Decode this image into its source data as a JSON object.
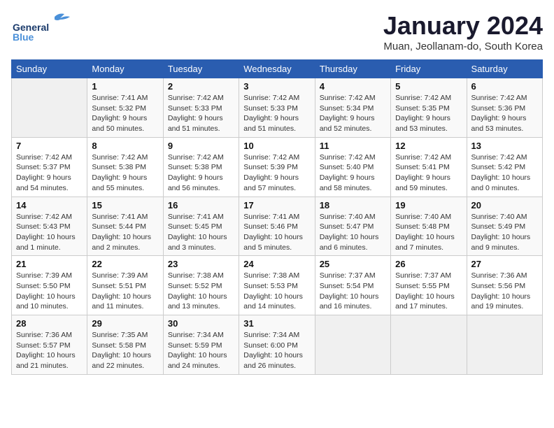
{
  "logo": {
    "line1": "General",
    "line2": "Blue"
  },
  "title": "January 2024",
  "location": "Muan, Jeollanam-do, South Korea",
  "days_of_week": [
    "Sunday",
    "Monday",
    "Tuesday",
    "Wednesday",
    "Thursday",
    "Friday",
    "Saturday"
  ],
  "weeks": [
    [
      {
        "day": "",
        "sunrise": "",
        "sunset": "",
        "daylight": ""
      },
      {
        "day": "1",
        "sunrise": "Sunrise: 7:41 AM",
        "sunset": "Sunset: 5:32 PM",
        "daylight": "Daylight: 9 hours and 50 minutes."
      },
      {
        "day": "2",
        "sunrise": "Sunrise: 7:42 AM",
        "sunset": "Sunset: 5:33 PM",
        "daylight": "Daylight: 9 hours and 51 minutes."
      },
      {
        "day": "3",
        "sunrise": "Sunrise: 7:42 AM",
        "sunset": "Sunset: 5:33 PM",
        "daylight": "Daylight: 9 hours and 51 minutes."
      },
      {
        "day": "4",
        "sunrise": "Sunrise: 7:42 AM",
        "sunset": "Sunset: 5:34 PM",
        "daylight": "Daylight: 9 hours and 52 minutes."
      },
      {
        "day": "5",
        "sunrise": "Sunrise: 7:42 AM",
        "sunset": "Sunset: 5:35 PM",
        "daylight": "Daylight: 9 hours and 53 minutes."
      },
      {
        "day": "6",
        "sunrise": "Sunrise: 7:42 AM",
        "sunset": "Sunset: 5:36 PM",
        "daylight": "Daylight: 9 hours and 53 minutes."
      }
    ],
    [
      {
        "day": "7",
        "sunrise": "Sunrise: 7:42 AM",
        "sunset": "Sunset: 5:37 PM",
        "daylight": "Daylight: 9 hours and 54 minutes."
      },
      {
        "day": "8",
        "sunrise": "Sunrise: 7:42 AM",
        "sunset": "Sunset: 5:38 PM",
        "daylight": "Daylight: 9 hours and 55 minutes."
      },
      {
        "day": "9",
        "sunrise": "Sunrise: 7:42 AM",
        "sunset": "Sunset: 5:38 PM",
        "daylight": "Daylight: 9 hours and 56 minutes."
      },
      {
        "day": "10",
        "sunrise": "Sunrise: 7:42 AM",
        "sunset": "Sunset: 5:39 PM",
        "daylight": "Daylight: 9 hours and 57 minutes."
      },
      {
        "day": "11",
        "sunrise": "Sunrise: 7:42 AM",
        "sunset": "Sunset: 5:40 PM",
        "daylight": "Daylight: 9 hours and 58 minutes."
      },
      {
        "day": "12",
        "sunrise": "Sunrise: 7:42 AM",
        "sunset": "Sunset: 5:41 PM",
        "daylight": "Daylight: 9 hours and 59 minutes."
      },
      {
        "day": "13",
        "sunrise": "Sunrise: 7:42 AM",
        "sunset": "Sunset: 5:42 PM",
        "daylight": "Daylight: 10 hours and 0 minutes."
      }
    ],
    [
      {
        "day": "14",
        "sunrise": "Sunrise: 7:42 AM",
        "sunset": "Sunset: 5:43 PM",
        "daylight": "Daylight: 10 hours and 1 minute."
      },
      {
        "day": "15",
        "sunrise": "Sunrise: 7:41 AM",
        "sunset": "Sunset: 5:44 PM",
        "daylight": "Daylight: 10 hours and 2 minutes."
      },
      {
        "day": "16",
        "sunrise": "Sunrise: 7:41 AM",
        "sunset": "Sunset: 5:45 PM",
        "daylight": "Daylight: 10 hours and 3 minutes."
      },
      {
        "day": "17",
        "sunrise": "Sunrise: 7:41 AM",
        "sunset": "Sunset: 5:46 PM",
        "daylight": "Daylight: 10 hours and 5 minutes."
      },
      {
        "day": "18",
        "sunrise": "Sunrise: 7:40 AM",
        "sunset": "Sunset: 5:47 PM",
        "daylight": "Daylight: 10 hours and 6 minutes."
      },
      {
        "day": "19",
        "sunrise": "Sunrise: 7:40 AM",
        "sunset": "Sunset: 5:48 PM",
        "daylight": "Daylight: 10 hours and 7 minutes."
      },
      {
        "day": "20",
        "sunrise": "Sunrise: 7:40 AM",
        "sunset": "Sunset: 5:49 PM",
        "daylight": "Daylight: 10 hours and 9 minutes."
      }
    ],
    [
      {
        "day": "21",
        "sunrise": "Sunrise: 7:39 AM",
        "sunset": "Sunset: 5:50 PM",
        "daylight": "Daylight: 10 hours and 10 minutes."
      },
      {
        "day": "22",
        "sunrise": "Sunrise: 7:39 AM",
        "sunset": "Sunset: 5:51 PM",
        "daylight": "Daylight: 10 hours and 11 minutes."
      },
      {
        "day": "23",
        "sunrise": "Sunrise: 7:38 AM",
        "sunset": "Sunset: 5:52 PM",
        "daylight": "Daylight: 10 hours and 13 minutes."
      },
      {
        "day": "24",
        "sunrise": "Sunrise: 7:38 AM",
        "sunset": "Sunset: 5:53 PM",
        "daylight": "Daylight: 10 hours and 14 minutes."
      },
      {
        "day": "25",
        "sunrise": "Sunrise: 7:37 AM",
        "sunset": "Sunset: 5:54 PM",
        "daylight": "Daylight: 10 hours and 16 minutes."
      },
      {
        "day": "26",
        "sunrise": "Sunrise: 7:37 AM",
        "sunset": "Sunset: 5:55 PM",
        "daylight": "Daylight: 10 hours and 17 minutes."
      },
      {
        "day": "27",
        "sunrise": "Sunrise: 7:36 AM",
        "sunset": "Sunset: 5:56 PM",
        "daylight": "Daylight: 10 hours and 19 minutes."
      }
    ],
    [
      {
        "day": "28",
        "sunrise": "Sunrise: 7:36 AM",
        "sunset": "Sunset: 5:57 PM",
        "daylight": "Daylight: 10 hours and 21 minutes."
      },
      {
        "day": "29",
        "sunrise": "Sunrise: 7:35 AM",
        "sunset": "Sunset: 5:58 PM",
        "daylight": "Daylight: 10 hours and 22 minutes."
      },
      {
        "day": "30",
        "sunrise": "Sunrise: 7:34 AM",
        "sunset": "Sunset: 5:59 PM",
        "daylight": "Daylight: 10 hours and 24 minutes."
      },
      {
        "day": "31",
        "sunrise": "Sunrise: 7:34 AM",
        "sunset": "Sunset: 6:00 PM",
        "daylight": "Daylight: 10 hours and 26 minutes."
      },
      {
        "day": "",
        "sunrise": "",
        "sunset": "",
        "daylight": ""
      },
      {
        "day": "",
        "sunrise": "",
        "sunset": "",
        "daylight": ""
      },
      {
        "day": "",
        "sunrise": "",
        "sunset": "",
        "daylight": ""
      }
    ]
  ]
}
